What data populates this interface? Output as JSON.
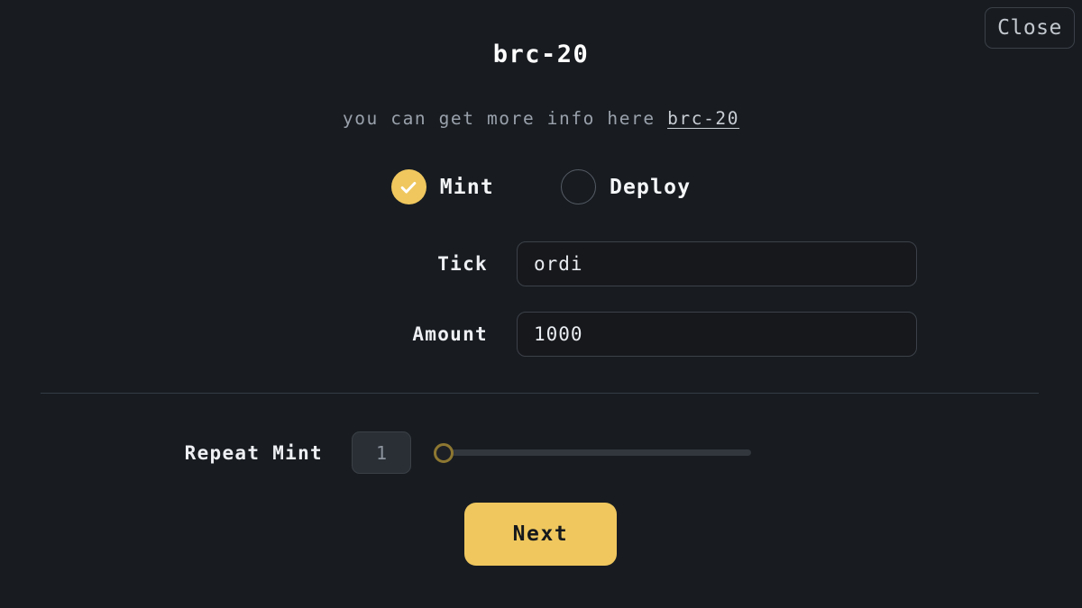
{
  "window": {
    "title": "brc-20",
    "close_label": "Close",
    "background_color": "#181c21",
    "accent_color": "#efc75e"
  },
  "subtitle": {
    "text": "you can get more info here ",
    "link_label": "brc-20"
  },
  "mode_selector": {
    "options": [
      {
        "label": "Mint",
        "selected": true
      },
      {
        "label": "Deploy",
        "selected": false
      }
    ],
    "selected_value": "Mint",
    "check_icon": "check-icon"
  },
  "fields": [
    {
      "label": "Tick",
      "value": "ordi",
      "placeholder": "ordi"
    },
    {
      "label": "Amount",
      "value": "1000",
      "placeholder": "1000"
    }
  ],
  "repeat_mint": {
    "label": "Repeat Mint",
    "count": "1",
    "slider_value": 1,
    "slider_min": 1,
    "slider_max": 100,
    "handle_color": "#8d7731",
    "track_color": "#32373e"
  },
  "actions": {
    "next_label": "Next"
  }
}
